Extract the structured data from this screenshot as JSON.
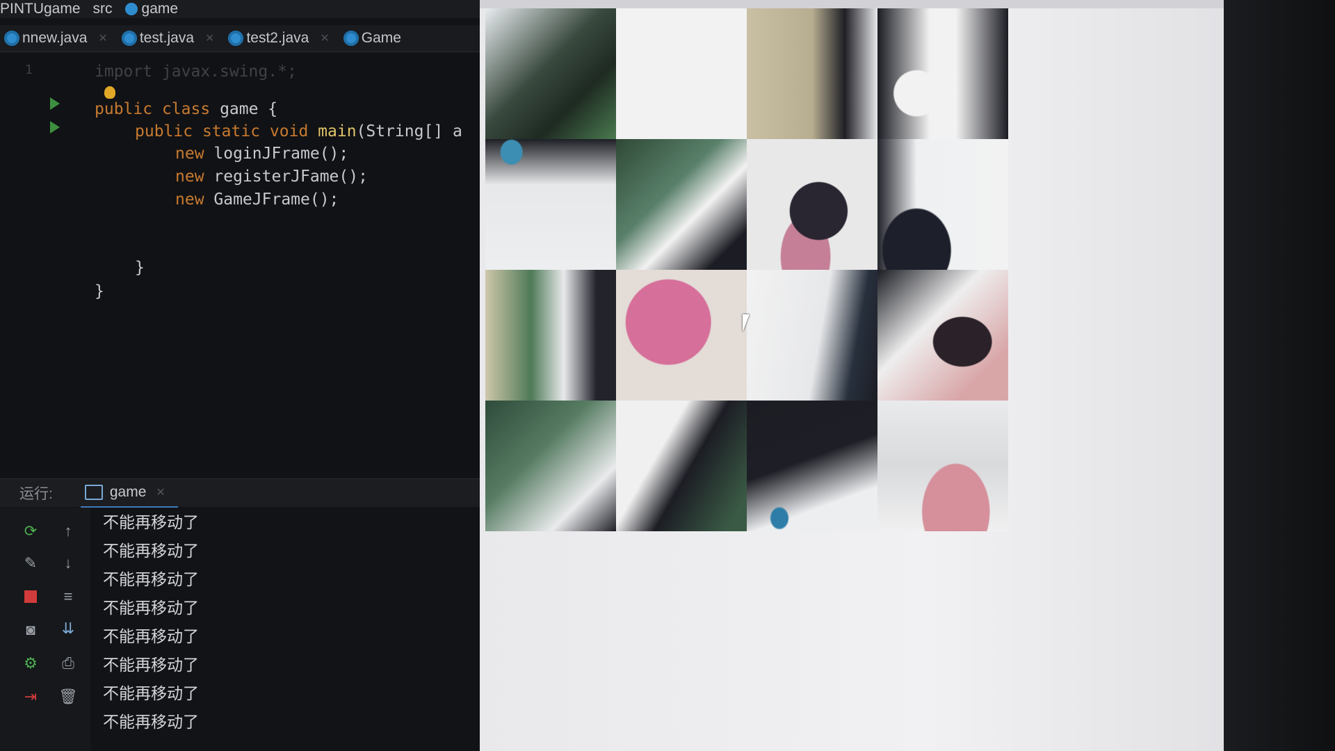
{
  "ide": {
    "breadcrumb": {
      "project": "PINTUgame",
      "folder": "src",
      "file": "game"
    },
    "tabs": [
      {
        "label": "nnew.java"
      },
      {
        "label": "test.java"
      },
      {
        "label": "test2.java"
      },
      {
        "label": "Game"
      }
    ],
    "code": {
      "line1": "import javax.swing.*;",
      "line_number_1": "1",
      "class_kw1": "public",
      "class_kw2": "class",
      "class_name": "game",
      "class_open": " {",
      "main_kw1": "public",
      "main_kw2": "static",
      "main_kw3": "void",
      "main_fn": "main",
      "main_args": "(String[] a",
      "stmt1_kw": "new",
      "stmt1": " loginJFrame();",
      "stmt2_kw": "new",
      "stmt2": " registerJFame();",
      "stmt3_kw": "new",
      "stmt3": " GameJFrame();",
      "close_inner": "}",
      "close_outer": "}"
    },
    "run_panel": {
      "label": "运行:",
      "tab": "game",
      "output": [
        "不能再移动了",
        "不能再移动了",
        "不能再移动了",
        "不能再移动了",
        "不能再移动了",
        "不能再移动了",
        "不能再移动了",
        "不能再移动了"
      ]
    }
  },
  "game": {
    "puzzle_tiles": 16
  },
  "colors": {
    "keyword": "#c77a2f",
    "function": "#e0c36a",
    "run_green": "#3c8f3f",
    "java_blue": "#2f8ccf"
  }
}
